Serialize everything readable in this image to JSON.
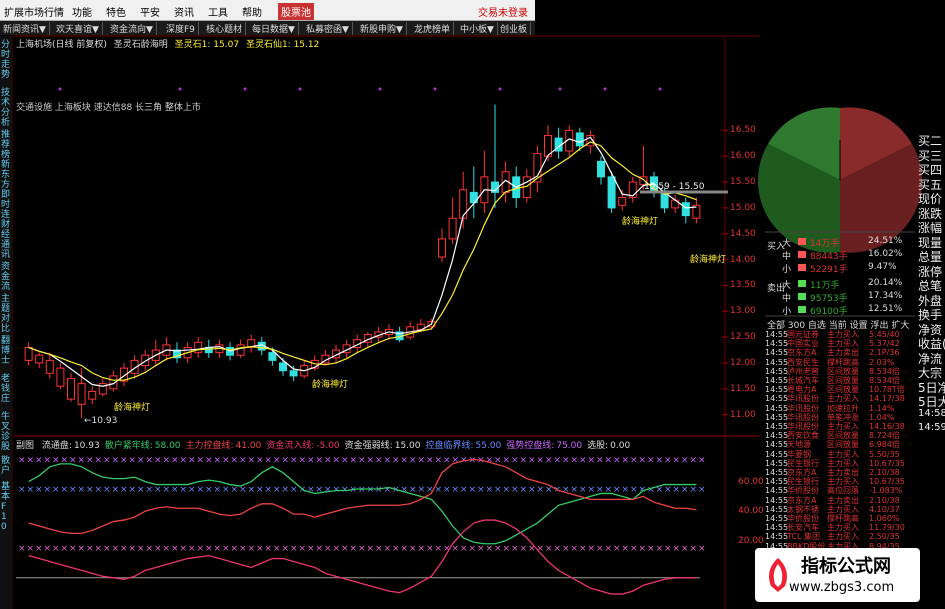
{
  "menu": {
    "items": [
      "扩展市场行情",
      "功能",
      "特色",
      "平安",
      "资讯",
      "工具",
      "帮助"
    ],
    "badge": "股票池",
    "login": "交易未登录"
  },
  "toolbar": {
    "items": [
      "新闻资讯▼",
      "欢天喜谊▼",
      "资金流向▼",
      "深度F9",
      "核心题材",
      "每日数据▼",
      "私募密函▼",
      "新股申购▼",
      "龙虎榜单",
      "中小板▼",
      "创业板"
    ]
  },
  "left_tabs": [
    "分时走势",
    "技术分析",
    "推荐榜",
    "新东方",
    "即时连",
    "财经通讯",
    "资金流",
    "主题对比",
    "翻博士",
    "老钱庄",
    "牛叉诊股",
    "散户",
    "基本F10"
  ],
  "header": {
    "stock": "上海机场(日线 前复权)",
    "indicator": "圣灵石龄海明",
    "v1_label": "圣灵石1:",
    "v1": "15.07",
    "v2_label": "圣灵石仙1:",
    "v2": "15.12"
  },
  "tags": "交通设施 上海板块 速达信88 长三角 整体上市",
  "signal_label": "龄海神灯",
  "low_label": "10.93",
  "range_label": "15.59 - 15.50",
  "sub_indicator": {
    "name": "副图",
    "items": [
      {
        "label": "流通盘:",
        "value": "10.93",
        "color": "#dddddd"
      },
      {
        "label": "散户紧牢线:",
        "value": "58.00",
        "color": "#33cc66"
      },
      {
        "label": "主力控盘线:",
        "value": "41.00",
        "color": "#ee4444"
      },
      {
        "label": "资金流入线:",
        "value": "-5.00",
        "color": "#ee3377"
      },
      {
        "label": "资金强弱线:",
        "value": "15.00",
        "color": "#dddddd"
      },
      {
        "label": "控盘临界线:",
        "value": "55.00",
        "color": "#6688ff"
      },
      {
        "label": "强势控盘线:",
        "value": "75.00",
        "color": "#cc66ff"
      },
      {
        "label": "选股:",
        "value": "0.00",
        "color": "#dddddd"
      }
    ]
  },
  "price_axis": [
    "16.50",
    "16.00",
    "15.50",
    "15.00",
    "14.50",
    "14.00",
    "13.50",
    "13.00",
    "12.50",
    "12.00",
    "11.50",
    "11.00"
  ],
  "sub_axis": [
    "60.00",
    "40.00",
    "20.00"
  ],
  "right_panel": {
    "buy": {
      "side_label": "买入",
      "rows": [
        {
          "size": "大",
          "volume": "14万手",
          "pct": "24.51%"
        },
        {
          "size": "中",
          "volume": "88443手",
          "pct": "16.02%"
        },
        {
          "size": "小",
          "volume": "52291手",
          "pct": "9.47%"
        }
      ]
    },
    "sell": {
      "side_label": "卖出",
      "rows": [
        {
          "size": "大",
          "volume": "11万手",
          "pct": "20.14%"
        },
        {
          "size": "中",
          "volume": "95753手",
          "pct": "17.34%"
        },
        {
          "size": "小",
          "volume": "69100手",
          "pct": "12.51%"
        }
      ]
    },
    "tabs": "全部 300 自选 当前 设置 浮出 扩大"
  },
  "far_right": [
    "买二",
    "买三",
    "买四",
    "买五",
    "现价",
    "涨跌",
    "涨幅",
    "现量",
    "总量",
    "涨停",
    "总笔",
    "外盘",
    "换手",
    "净资",
    "收益(",
    "净流",
    "大宗",
    "5日净",
    "5日大",
    "14:58",
    "14:59"
  ],
  "stock_rows": [
    {
      "time": "14:55",
      "name": "国元证券",
      "type": "主力买入",
      "value": "5.45/40"
    },
    {
      "time": "14:55",
      "name": "中国实业",
      "type": "主力买入",
      "value": "5.37/42"
    },
    {
      "time": "14:55",
      "name": "京东方A",
      "type": "主力卖出",
      "value": "2.1P/36"
    },
    {
      "time": "14:55",
      "name": "西安民生",
      "type": "撑杆跳高",
      "value": "2.03%"
    },
    {
      "time": "14:55",
      "name": "泸州老窖",
      "type": "区间放量",
      "value": "8.534倍"
    },
    {
      "time": "14:55",
      "name": "长城汽车",
      "type": "区间放量",
      "value": "8.534倍"
    },
    {
      "time": "14:55",
      "name": "粤电力A",
      "type": "区间放量",
      "value": "10.78T倍"
    },
    {
      "time": "14:55",
      "name": "华讯股份",
      "type": "主力买入",
      "value": "14.17/38"
    },
    {
      "time": "14:55",
      "name": "华讯股份",
      "type": "加速拉升",
      "value": "1.14%"
    },
    {
      "time": "14:55",
      "name": "华讯股份",
      "type": "单笔冲涨",
      "value": "1.04%"
    },
    {
      "time": "14:55",
      "name": "华讯股份",
      "type": "主力买入",
      "value": "14.16/38"
    },
    {
      "time": "14:55",
      "name": "西安饮食",
      "type": "区间放量",
      "value": "8.724倍"
    },
    {
      "time": "14:55",
      "name": "天地源",
      "type": "区间放量",
      "value": "6.984倍"
    },
    {
      "time": "14:55",
      "name": "华菱钢",
      "type": "主力买入",
      "value": "5.50/35"
    },
    {
      "time": "14:55",
      "name": "民生银行",
      "type": "主力买入",
      "value": "10.67/35"
    },
    {
      "time": "14:55",
      "name": "京东方A",
      "type": "主力卖出",
      "value": "2.10/38"
    },
    {
      "time": "14:55",
      "name": "民生银行",
      "type": "主力买入",
      "value": "10.67/35"
    },
    {
      "time": "14:55",
      "name": "华侨股份",
      "type": "高位回落",
      "value": "-1.083%"
    },
    {
      "time": "14:55",
      "name": "京东方A",
      "type": "主力卖出",
      "value": "2.10/38"
    },
    {
      "time": "14:55",
      "name": "太钢不锈",
      "type": "主力买入",
      "value": "4.10/37"
    },
    {
      "time": "14:55",
      "name": "华侨股份",
      "type": "撑杆跳高",
      "value": "1.060%"
    },
    {
      "time": "14:55",
      "name": "长安汽车",
      "type": "主力买入",
      "value": "11.79/30"
    },
    {
      "time": "14:55",
      "name": "TCL 集团",
      "type": "主力买入",
      "value": "2.50/35"
    },
    {
      "time": "14:55",
      "name": "BBKD股份",
      "type": "主力买入",
      "value": "8.94/35"
    }
  ],
  "watermark": {
    "line1": "指标公式网",
    "line2": "www.zbgs3.com"
  },
  "chart_data": {
    "type": "candlestick",
    "price_range": [
      10.8,
      16.7
    ],
    "candles": [
      {
        "x": 1,
        "o": 12.05,
        "c": 12.3,
        "h": 12.4,
        "l": 11.95
      },
      {
        "x": 2,
        "o": 12.0,
        "c": 12.15,
        "h": 12.2,
        "l": 11.9
      },
      {
        "x": 3,
        "o": 11.8,
        "c": 12.05,
        "h": 12.2,
        "l": 11.7
      },
      {
        "x": 4,
        "o": 11.55,
        "c": 11.9,
        "h": 12.0,
        "l": 11.5
      },
      {
        "x": 5,
        "o": 11.3,
        "c": 11.7,
        "h": 11.8,
        "l": 11.25
      },
      {
        "x": 6,
        "o": 11.2,
        "c": 11.6,
        "h": 11.9,
        "l": 10.93
      },
      {
        "x": 7,
        "o": 11.3,
        "c": 11.45,
        "h": 11.55,
        "l": 11.2
      },
      {
        "x": 8,
        "o": 11.4,
        "c": 11.6,
        "h": 11.7,
        "l": 11.35
      },
      {
        "x": 9,
        "o": 11.5,
        "c": 11.75,
        "h": 11.85,
        "l": 11.45
      },
      {
        "x": 10,
        "o": 11.65,
        "c": 11.9,
        "h": 12.0,
        "l": 11.55
      },
      {
        "x": 11,
        "o": 11.8,
        "c": 12.05,
        "h": 12.15,
        "l": 11.7
      },
      {
        "x": 12,
        "o": 11.95,
        "c": 12.15,
        "h": 12.25,
        "l": 11.85
      },
      {
        "x": 13,
        "o": 12.05,
        "c": 12.25,
        "h": 12.45,
        "l": 11.95
      },
      {
        "x": 14,
        "o": 12.15,
        "c": 12.35,
        "h": 12.5,
        "l": 12.05
      },
      {
        "x": 15,
        "o": 12.25,
        "c": 12.1,
        "h": 12.4,
        "l": 12.0
      },
      {
        "x": 16,
        "o": 12.1,
        "c": 12.3,
        "h": 12.4,
        "l": 12.0
      },
      {
        "x": 17,
        "o": 12.2,
        "c": 12.4,
        "h": 12.5,
        "l": 12.1
      },
      {
        "x": 18,
        "o": 12.3,
        "c": 12.2,
        "h": 12.45,
        "l": 12.1
      },
      {
        "x": 19,
        "o": 12.2,
        "c": 12.35,
        "h": 12.45,
        "l": 12.1
      },
      {
        "x": 20,
        "o": 12.3,
        "c": 12.15,
        "h": 12.4,
        "l": 12.05
      },
      {
        "x": 21,
        "o": 12.15,
        "c": 12.35,
        "h": 12.45,
        "l": 12.1
      },
      {
        "x": 22,
        "o": 12.3,
        "c": 12.45,
        "h": 12.55,
        "l": 12.2
      },
      {
        "x": 23,
        "o": 12.4,
        "c": 12.25,
        "h": 12.5,
        "l": 12.15
      },
      {
        "x": 24,
        "o": 12.2,
        "c": 12.05,
        "h": 12.3,
        "l": 11.95
      },
      {
        "x": 25,
        "o": 12.0,
        "c": 11.85,
        "h": 12.1,
        "l": 11.75
      },
      {
        "x": 26,
        "o": 11.85,
        "c": 11.75,
        "h": 11.95,
        "l": 11.65
      },
      {
        "x": 27,
        "o": 11.75,
        "c": 11.95,
        "h": 12.05,
        "l": 11.7
      },
      {
        "x": 28,
        "o": 11.9,
        "c": 12.05,
        "h": 12.15,
        "l": 11.85
      },
      {
        "x": 29,
        "o": 12.0,
        "c": 12.15,
        "h": 12.25,
        "l": 11.95
      },
      {
        "x": 30,
        "o": 12.1,
        "c": 12.25,
        "h": 12.35,
        "l": 12.0
      },
      {
        "x": 31,
        "o": 12.2,
        "c": 12.35,
        "h": 12.45,
        "l": 12.1
      },
      {
        "x": 32,
        "o": 12.3,
        "c": 12.45,
        "h": 12.55,
        "l": 12.2
      },
      {
        "x": 33,
        "o": 12.4,
        "c": 12.55,
        "h": 12.6,
        "l": 12.3
      },
      {
        "x": 34,
        "o": 12.5,
        "c": 12.6,
        "h": 12.7,
        "l": 12.4
      },
      {
        "x": 35,
        "o": 12.55,
        "c": 12.65,
        "h": 12.75,
        "l": 12.45
      },
      {
        "x": 36,
        "o": 12.6,
        "c": 12.45,
        "h": 12.7,
        "l": 12.4
      },
      {
        "x": 37,
        "o": 12.5,
        "c": 12.7,
        "h": 12.8,
        "l": 12.45
      },
      {
        "x": 38,
        "o": 12.65,
        "c": 12.75,
        "h": 12.85,
        "l": 12.6
      },
      {
        "x": 39,
        "o": 12.7,
        "c": 12.8,
        "h": 12.85,
        "l": 12.65
      },
      {
        "x": 40,
        "o": 14.05,
        "c": 14.4,
        "h": 14.6,
        "l": 13.95
      },
      {
        "x": 41,
        "o": 14.4,
        "c": 14.8,
        "h": 15.2,
        "l": 14.3
      },
      {
        "x": 42,
        "o": 14.8,
        "c": 15.35,
        "h": 15.7,
        "l": 14.6
      },
      {
        "x": 43,
        "o": 15.3,
        "c": 15.1,
        "h": 15.8,
        "l": 14.8
      },
      {
        "x": 44,
        "o": 15.1,
        "c": 15.6,
        "h": 16.1,
        "l": 14.9
      },
      {
        "x": 45,
        "o": 15.5,
        "c": 15.3,
        "h": 17.0,
        "l": 15.0
      },
      {
        "x": 46,
        "o": 15.3,
        "c": 15.7,
        "h": 15.9,
        "l": 15.1
      },
      {
        "x": 47,
        "o": 15.6,
        "c": 15.2,
        "h": 15.8,
        "l": 15.0
      },
      {
        "x": 48,
        "o": 15.2,
        "c": 15.6,
        "h": 15.75,
        "l": 15.1
      },
      {
        "x": 49,
        "o": 15.5,
        "c": 16.05,
        "h": 16.2,
        "l": 15.3
      },
      {
        "x": 50,
        "o": 16.0,
        "c": 16.4,
        "h": 16.6,
        "l": 15.9
      },
      {
        "x": 51,
        "o": 16.35,
        "c": 16.1,
        "h": 16.55,
        "l": 15.95
      },
      {
        "x": 52,
        "o": 16.1,
        "c": 16.5,
        "h": 16.6,
        "l": 16.0
      },
      {
        "x": 53,
        "o": 16.45,
        "c": 16.2,
        "h": 16.55,
        "l": 16.1
      },
      {
        "x": 54,
        "o": 16.2,
        "c": 16.4,
        "h": 16.5,
        "l": 16.05
      },
      {
        "x": 55,
        "o": 15.9,
        "c": 15.6,
        "h": 16.0,
        "l": 15.45
      },
      {
        "x": 56,
        "o": 15.6,
        "c": 15.0,
        "h": 15.7,
        "l": 14.9
      },
      {
        "x": 57,
        "o": 15.05,
        "c": 15.2,
        "h": 15.35,
        "l": 14.95
      },
      {
        "x": 58,
        "o": 15.2,
        "c": 15.5,
        "h": 15.6,
        "l": 15.1
      },
      {
        "x": 59,
        "o": 15.45,
        "c": 15.6,
        "h": 16.2,
        "l": 15.35
      },
      {
        "x": 60,
        "o": 15.6,
        "c": 15.3,
        "h": 15.7,
        "l": 15.2
      },
      {
        "x": 61,
        "o": 15.3,
        "c": 15.0,
        "h": 15.4,
        "l": 14.9
      },
      {
        "x": 62,
        "o": 15.0,
        "c": 15.15,
        "h": 15.25,
        "l": 14.9
      },
      {
        "x": 63,
        "o": 15.1,
        "c": 14.85,
        "h": 15.2,
        "l": 14.7
      },
      {
        "x": 64,
        "o": 14.8,
        "c": 15.05,
        "h": 15.2,
        "l": 14.7
      }
    ],
    "sub_chart": {
      "ylim": [
        -20,
        80
      ],
      "reference_lines": [
        75,
        55,
        15
      ],
      "series": [
        {
          "name": "散户紧牢线",
          "color": "#33cc66",
          "values": [
            60,
            64,
            70,
            72,
            72,
            70,
            66,
            63,
            62,
            62,
            63,
            60,
            58,
            58,
            58,
            58,
            60,
            61,
            60,
            58,
            57,
            60,
            66,
            70,
            66,
            60,
            54,
            52,
            53,
            54,
            54,
            55,
            55,
            55,
            56,
            54,
            52,
            50,
            48,
            40,
            30,
            22,
            19,
            18,
            18,
            20,
            24,
            28,
            32,
            38,
            44,
            46,
            48,
            50,
            52,
            52,
            50,
            48,
            54,
            56,
            58,
            58,
            58,
            58
          ]
        },
        {
          "name": "主力控盘线",
          "color": "#ee4444",
          "values": [
            32,
            30,
            28,
            26,
            25,
            25,
            27,
            30,
            33,
            34,
            36,
            40,
            42,
            43,
            42,
            42,
            42,
            40,
            38,
            37,
            38,
            42,
            45,
            45,
            42,
            38,
            38,
            36,
            38,
            40,
            42,
            43,
            44,
            44,
            44,
            44,
            45,
            48,
            52,
            66,
            72,
            74,
            75,
            74,
            72,
            70,
            66,
            62,
            60,
            58,
            54,
            52,
            50,
            48,
            48,
            48,
            48,
            48,
            50,
            46,
            44,
            42,
            42,
            41
          ]
        },
        {
          "name": "资金流入线",
          "color": "#ee3377",
          "values": [
            10,
            8,
            6,
            4,
            2,
            0,
            -2,
            -4,
            -5,
            -6,
            -4,
            0,
            2,
            4,
            6,
            8,
            9,
            10,
            8,
            6,
            4,
            2,
            5,
            8,
            8,
            6,
            4,
            2,
            -2,
            -4,
            -6,
            -8,
            -10,
            -12,
            -14,
            -15,
            -12,
            -8,
            -4,
            6,
            18,
            26,
            32,
            34,
            34,
            32,
            28,
            22,
            14,
            6,
            0,
            -4,
            -8,
            -12,
            -14,
            -16,
            -16,
            -14,
            -10,
            -8,
            -6,
            -5,
            -5,
            -5
          ]
        }
      ]
    }
  }
}
